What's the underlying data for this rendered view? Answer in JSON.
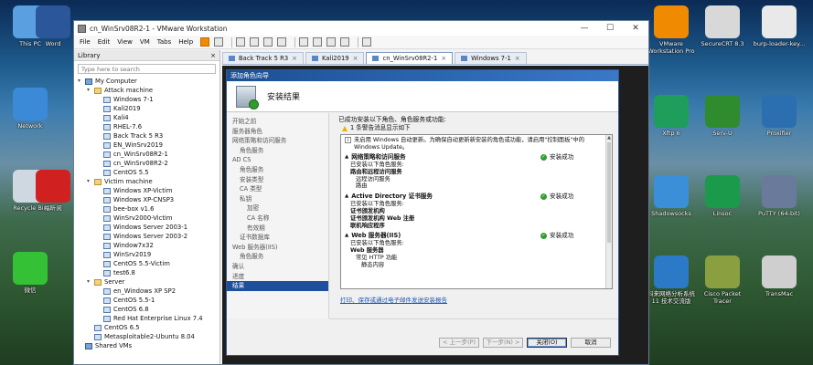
{
  "desktop_left": [
    {
      "label": "This PC",
      "icon": "this-pc-icon",
      "color": "#5aa0e0"
    },
    {
      "label": "Network",
      "icon": "network-icon",
      "color": "#3b8ad8"
    },
    {
      "label": "Recycle Bin",
      "icon": "recycle-bin-icon",
      "color": "#cfd8e0"
    },
    {
      "label": "微信",
      "icon": "wechat-icon",
      "color": "#35c135"
    }
  ],
  "desktop_left2": [
    {
      "label": "Word",
      "icon": "word-icon",
      "color": "#2b579a"
    },
    {
      "label": "福昕阅",
      "icon": "foxit-icon",
      "color": "#d02020"
    }
  ],
  "desktop_right": [
    {
      "label": "VMware Workstation Pro",
      "icon": "vmware-icon",
      "color": "#f08a00"
    },
    {
      "label": "SecureCRT 8.3",
      "icon": "securecrt-icon",
      "color": "#d8d8d8"
    },
    {
      "label": "burp-loader-key...",
      "icon": "java-icon",
      "color": "#e9e9e9"
    },
    {
      "label": "Xftp 6",
      "icon": "xftp-icon",
      "color": "#1e9e5a"
    },
    {
      "label": "Serv-U",
      "icon": "servu-icon",
      "color": "#2e8b2e"
    },
    {
      "label": "Proxifier",
      "icon": "proxifier-icon",
      "color": "#2c6fb0"
    },
    {
      "label": "Shadowsocks",
      "icon": "shadowsocks-icon",
      "color": "#3a8fd8"
    },
    {
      "label": "Linsoc",
      "icon": "linsoc-icon",
      "color": "#1a9a4a"
    },
    {
      "label": "PuTTY (64-bit)",
      "icon": "putty-icon",
      "color": "#6a7a9a"
    },
    {
      "label": "科来网络分析系统11 技术交流版",
      "icon": "colasoft-icon",
      "color": "#2a7ac8"
    },
    {
      "label": "Cisco Packet Tracer",
      "icon": "packet-tracer-icon",
      "color": "#8aa040"
    },
    {
      "label": "TransMac",
      "icon": "transmac-icon",
      "color": "#cfcfcf"
    }
  ],
  "window": {
    "title": "cn_WinSrv08R2-1 - VMware Workstation",
    "menus": [
      "File",
      "Edit",
      "View",
      "VM",
      "Tabs",
      "Help"
    ]
  },
  "library": {
    "title": "Library",
    "close": "×",
    "search_placeholder": "Type here to search",
    "tree": [
      {
        "label": "My Computer",
        "level": 0,
        "type": "pc",
        "toggle": "▢"
      },
      {
        "label": "Attack machine",
        "level": 1,
        "type": "folder",
        "toggle": "▢"
      },
      {
        "label": "Windows 7-1",
        "level": 2,
        "type": "vm"
      },
      {
        "label": "Kali2019",
        "level": 2,
        "type": "vm"
      },
      {
        "label": "Kali4",
        "level": 2,
        "type": "vm"
      },
      {
        "label": "RHEL-7.6",
        "level": 2,
        "type": "vm"
      },
      {
        "label": "Back Track 5 R3",
        "level": 2,
        "type": "vm"
      },
      {
        "label": "EN_WinSrv2019",
        "level": 2,
        "type": "vm"
      },
      {
        "label": "cn_WinSrv08R2-1",
        "level": 2,
        "type": "vm"
      },
      {
        "label": "cn_WinSrv08R2-2",
        "level": 2,
        "type": "vm"
      },
      {
        "label": "CentOS 5.5",
        "level": 2,
        "type": "vm"
      },
      {
        "label": "Victim machine",
        "level": 1,
        "type": "folder",
        "toggle": "▢"
      },
      {
        "label": "Windows XP-Victim",
        "level": 2,
        "type": "vm"
      },
      {
        "label": "Windows XP-CNSP3",
        "level": 2,
        "type": "vm"
      },
      {
        "label": "bee-box v1.6",
        "level": 2,
        "type": "vm"
      },
      {
        "label": "WinSrv2000-Victim",
        "level": 2,
        "type": "vm"
      },
      {
        "label": "Windows Server 2003-1",
        "level": 2,
        "type": "vm"
      },
      {
        "label": "Windows Server 2003-2",
        "level": 2,
        "type": "vm"
      },
      {
        "label": "Window7x32",
        "level": 2,
        "type": "vm"
      },
      {
        "label": "WinSrv2019",
        "level": 2,
        "type": "vm"
      },
      {
        "label": "CentOS 5.5-Victim",
        "level": 2,
        "type": "vm"
      },
      {
        "label": "test6.8",
        "level": 2,
        "type": "vm"
      },
      {
        "label": "Server",
        "level": 1,
        "type": "folder",
        "toggle": "▢"
      },
      {
        "label": "en_Windows XP SP2",
        "level": 2,
        "type": "vm"
      },
      {
        "label": "CentOS 5.5-1",
        "level": 2,
        "type": "vm"
      },
      {
        "label": "CentOS 6.8",
        "level": 2,
        "type": "vm"
      },
      {
        "label": "Red Hat Enterprise Linux 7.4",
        "level": 2,
        "type": "vm"
      },
      {
        "label": "CentOS 6.5",
        "level": 1,
        "type": "vm"
      },
      {
        "label": "Metasploitable2-Ubuntu 8.04",
        "level": 1,
        "type": "vm"
      },
      {
        "label": "Shared VMs",
        "level": 0,
        "type": "pc"
      }
    ]
  },
  "tabs": [
    {
      "label": "Back Track 5 R3",
      "active": false
    },
    {
      "label": "Kali2019",
      "active": false
    },
    {
      "label": "cn_WinSrv08R2-1",
      "active": true
    },
    {
      "label": "Windows 7-1",
      "active": false
    }
  ],
  "wizard": {
    "title": "添加角色向导",
    "header": "安装结果",
    "steps": [
      {
        "label": "开始之前",
        "level": 1
      },
      {
        "label": "服务器角色",
        "level": 1
      },
      {
        "label": "网络策略和访问服务",
        "level": 1
      },
      {
        "label": "角色服务",
        "level": 2
      },
      {
        "label": "AD CS",
        "level": 1
      },
      {
        "label": "角色服务",
        "level": 2
      },
      {
        "label": "安装类型",
        "level": 2
      },
      {
        "label": "CA 类型",
        "level": 2
      },
      {
        "label": "私钥",
        "level": 2
      },
      {
        "label": "加密",
        "level": 3
      },
      {
        "label": "CA 名称",
        "level": 3
      },
      {
        "label": "有效期",
        "level": 3
      },
      {
        "label": "证书数据库",
        "level": 2
      },
      {
        "label": "Web 服务器(IIS)",
        "level": 1
      },
      {
        "label": "角色服务",
        "level": 2
      },
      {
        "label": "确认",
        "level": 1
      },
      {
        "label": "进度",
        "level": 1
      },
      {
        "label": "结果",
        "level": 1,
        "active": true
      }
    ],
    "summary": "已成功安装以下角色、角色服务或功能:",
    "warning": "1 条警告消息显示如下",
    "note": "未启用 Windows 自动更新。为确保自动更新新安装的角色或功能，请启用\"控制面板\"中的 Windows Update。",
    "sections": [
      {
        "name": "网络策略和访问服务",
        "status": "安装成功",
        "items": [
          {
            "text": "已安装以下角色服务:",
            "style": "plain"
          },
          {
            "text": "路由和远程访问服务",
            "style": "bold"
          },
          {
            "text": "远程访问服务",
            "style": "i2"
          },
          {
            "text": "路由",
            "style": "i2"
          }
        ]
      },
      {
        "name": "Active Directory 证书服务",
        "status": "安装成功",
        "items": [
          {
            "text": "已安装以下角色服务:",
            "style": "plain"
          },
          {
            "text": "证书颁发机构",
            "style": "bold"
          },
          {
            "text": "证书颁发机构 Web 注册",
            "style": "bold"
          },
          {
            "text": "联机响应程序",
            "style": "bold"
          }
        ]
      },
      {
        "name": "Web 服务器(IIS)",
        "status": "安装成功",
        "items": [
          {
            "text": "已安装以下角色服务:",
            "style": "plain"
          },
          {
            "text": "Web 服务器",
            "style": "bold"
          },
          {
            "text": "常见 HTTP 功能",
            "style": "i2"
          },
          {
            "text": "静态内容",
            "style": "i3"
          }
        ]
      }
    ],
    "link": "打印、保存或通过电子邮件发送安装报告",
    "buttons": {
      "prev": "< 上一步(P)",
      "next": "下一步(N) >",
      "close": "关闭(O)",
      "cancel": "取消"
    }
  }
}
